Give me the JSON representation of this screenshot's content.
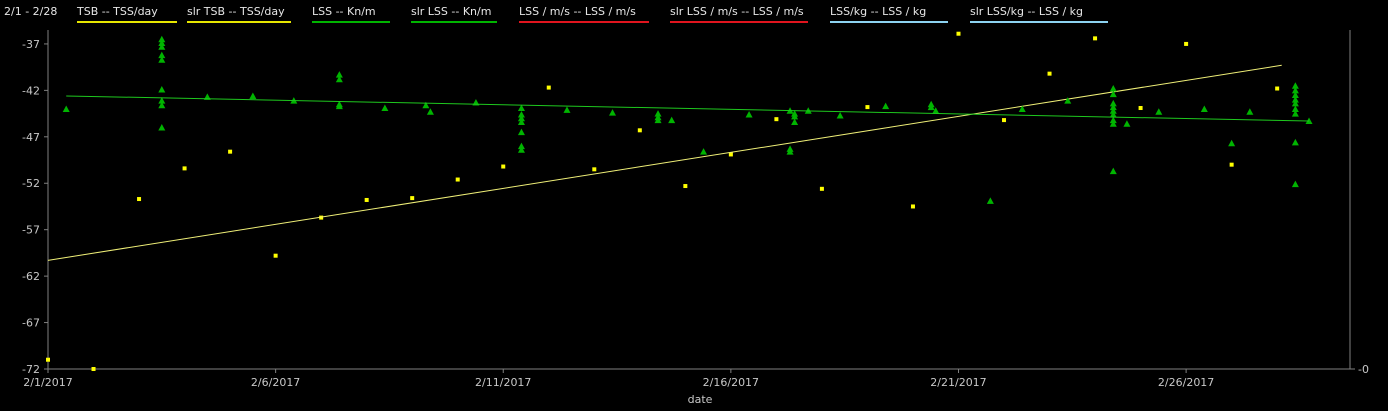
{
  "range_label": "2/1 - 2/28",
  "legend": [
    {
      "label": "TSB  -- TSS/day",
      "color": "#e6e600"
    },
    {
      "label": "slr TSB  -- TSS/day",
      "color": "#e6e600"
    },
    {
      "label": "LSS  -- Kn/m",
      "color": "#00b400"
    },
    {
      "label": "slr LSS  -- Kn/m",
      "color": "#00b400"
    },
    {
      "label": "LSS / m/s  -- LSS / m/s",
      "color": "#e0141e"
    },
    {
      "label": "slr LSS / m/s  -- LSS / m/s",
      "color": "#e0141e"
    },
    {
      "label": "LSS/kg  -- LSS / kg",
      "color": "#8cd2f0"
    },
    {
      "label": "slr LSS/kg  -- LSS / kg",
      "color": "#8cd2f0"
    }
  ],
  "chart_data": {
    "type": "scatter",
    "title": "",
    "xlabel": "date",
    "ylabel": "",
    "x_ticks": [
      "2/1/2017",
      "2/6/2017",
      "2/11/2017",
      "2/16/2017",
      "2/21/2017",
      "2/26/2017"
    ],
    "y_ticks": [
      "-37",
      "-42",
      "-47",
      "-52",
      "-57",
      "-62",
      "-67",
      "-72"
    ],
    "y_right_ticks": [
      "0"
    ],
    "xlim": [
      0,
      28.6
    ],
    "ylim": [
      -72,
      -35.5
    ],
    "grid": false,
    "legend_position": "top",
    "colors": {
      "tsb": "#ffff00",
      "lss": "#00b400",
      "slr_tsb": "#f0f078",
      "slr_lss": "#1ec81e",
      "axis": "#808080"
    },
    "series": [
      {
        "name": "TSB  -- TSS/day",
        "marker": "square",
        "points": [
          [
            0.0,
            -71.0
          ],
          [
            1.0,
            -72.0
          ],
          [
            2.0,
            -53.7
          ],
          [
            3.0,
            -50.4
          ],
          [
            4.0,
            -48.6
          ],
          [
            5.0,
            -59.8
          ],
          [
            6.0,
            -55.7
          ],
          [
            7.0,
            -53.8
          ],
          [
            8.0,
            -53.6
          ],
          [
            9.0,
            -51.6
          ],
          [
            10.0,
            -50.2
          ],
          [
            11.0,
            -41.7
          ],
          [
            12.0,
            -50.5
          ],
          [
            13.0,
            -46.3
          ],
          [
            14.0,
            -52.3
          ],
          [
            15.0,
            -48.9
          ],
          [
            16.0,
            -45.1
          ],
          [
            17.0,
            -52.6
          ],
          [
            18.0,
            -43.8
          ],
          [
            19.0,
            -54.5
          ],
          [
            20.0,
            -35.9
          ],
          [
            21.0,
            -45.2
          ],
          [
            22.0,
            -40.2
          ],
          [
            23.0,
            -36.4
          ],
          [
            24.0,
            -43.9
          ],
          [
            25.0,
            -37.0
          ],
          [
            26.0,
            -50.0
          ],
          [
            27.0,
            -41.8
          ]
        ]
      },
      {
        "name": "slr TSB  -- TSS/day",
        "type": "line",
        "points": [
          [
            0.0,
            -60.3
          ],
          [
            27.1,
            -39.3
          ]
        ]
      },
      {
        "name": "LSS  -- Kn/m",
        "marker": "triangle",
        "points": [
          [
            0.4,
            -44.0
          ],
          [
            2.5,
            -36.5
          ],
          [
            2.5,
            -36.9
          ],
          [
            2.5,
            -37.3
          ],
          [
            2.5,
            -38.2
          ],
          [
            2.5,
            -38.7
          ],
          [
            2.5,
            -41.9
          ],
          [
            2.5,
            -43.1
          ],
          [
            2.5,
            -43.6
          ],
          [
            2.5,
            -46.0
          ],
          [
            3.5,
            -42.7
          ],
          [
            4.5,
            -42.6
          ],
          [
            5.4,
            -43.1
          ],
          [
            6.4,
            -40.3
          ],
          [
            6.4,
            -40.8
          ],
          [
            6.4,
            -43.5
          ],
          [
            6.4,
            -43.7
          ],
          [
            7.4,
            -43.9
          ],
          [
            8.3,
            -43.6
          ],
          [
            8.4,
            -44.3
          ],
          [
            9.4,
            -43.3
          ],
          [
            10.4,
            -43.9
          ],
          [
            10.4,
            -44.6
          ],
          [
            10.4,
            -45.0
          ],
          [
            10.4,
            -45.4
          ],
          [
            10.4,
            -46.5
          ],
          [
            10.4,
            -48.0
          ],
          [
            10.4,
            -48.4
          ],
          [
            11.4,
            -44.1
          ],
          [
            12.4,
            -44.4
          ],
          [
            13.4,
            -44.5
          ],
          [
            13.4,
            -44.9
          ],
          [
            13.4,
            -45.2
          ],
          [
            13.7,
            -45.2
          ],
          [
            14.4,
            -48.6
          ],
          [
            15.4,
            -44.6
          ],
          [
            16.3,
            -44.2
          ],
          [
            16.4,
            -44.5
          ],
          [
            16.4,
            -44.8
          ],
          [
            16.4,
            -45.4
          ],
          [
            16.3,
            -48.3
          ],
          [
            16.3,
            -48.6
          ],
          [
            16.7,
            -44.2
          ],
          [
            17.4,
            -44.7
          ],
          [
            18.4,
            -43.7
          ],
          [
            19.4,
            -43.5
          ],
          [
            19.4,
            -43.8
          ],
          [
            19.5,
            -44.2
          ],
          [
            20.7,
            -53.9
          ],
          [
            21.4,
            -44.0
          ],
          [
            22.4,
            -43.1
          ],
          [
            23.4,
            -41.8
          ],
          [
            23.4,
            -42.4
          ],
          [
            23.4,
            -43.4
          ],
          [
            23.4,
            -43.8
          ],
          [
            23.4,
            -44.2
          ],
          [
            23.4,
            -44.6
          ],
          [
            23.4,
            -45.2
          ],
          [
            23.4,
            -45.6
          ],
          [
            23.4,
            -50.7
          ],
          [
            23.7,
            -45.6
          ],
          [
            24.4,
            -44.3
          ],
          [
            25.4,
            -44.0
          ],
          [
            26.0,
            -47.7
          ],
          [
            26.4,
            -44.3
          ],
          [
            27.4,
            -41.5
          ],
          [
            27.4,
            -42.0
          ],
          [
            27.4,
            -42.5
          ],
          [
            27.4,
            -43.0
          ],
          [
            27.4,
            -43.4
          ],
          [
            27.4,
            -44.0
          ],
          [
            27.4,
            -44.5
          ],
          [
            27.4,
            -47.6
          ],
          [
            27.4,
            -52.1
          ],
          [
            27.7,
            -45.3
          ]
        ]
      },
      {
        "name": "slr LSS  -- Kn/m",
        "type": "line",
        "points": [
          [
            0.4,
            -42.6
          ],
          [
            27.7,
            -45.3
          ]
        ]
      }
    ]
  }
}
